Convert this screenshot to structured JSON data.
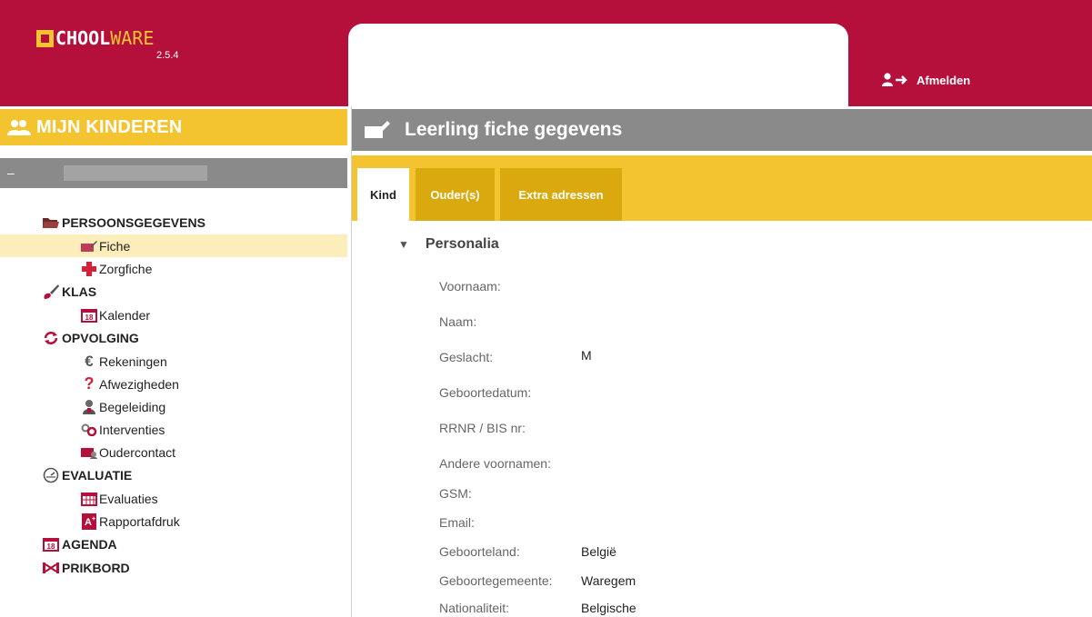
{
  "header": {
    "logo_text_main": "CHOOL",
    "logo_text_accent": "WARE",
    "version": "2.5.4",
    "logout_label": "Afmelden"
  },
  "sidebar": {
    "title": "MIJN KINDEREN",
    "collapse_symbol": "–",
    "sections": [
      {
        "label": "PERSOONSGEGEVENS",
        "icon": "folder-icon",
        "items": [
          {
            "label": "Fiche",
            "icon": "edit-card-icon",
            "active": true
          },
          {
            "label": "Zorgfiche",
            "icon": "red-cross-icon"
          }
        ]
      },
      {
        "label": "KLAS",
        "icon": "brush-icon",
        "items": [
          {
            "label": "Kalender",
            "icon": "calendar-icon"
          }
        ]
      },
      {
        "label": "OPVOLGING",
        "icon": "refresh-icon",
        "items": [
          {
            "label": "Rekeningen",
            "icon": "euro-icon"
          },
          {
            "label": "Afwezigheden",
            "icon": "question-icon"
          },
          {
            "label": "Begeleiding",
            "icon": "person-icon"
          },
          {
            "label": "Interventies",
            "icon": "link-icon"
          },
          {
            "label": "Oudercontact",
            "icon": "contact-icon"
          }
        ]
      },
      {
        "label": "EVALUATIE",
        "icon": "gauge-icon",
        "items": [
          {
            "label": "Evaluaties",
            "icon": "calendar-grid-icon"
          },
          {
            "label": "Rapportafdruk",
            "icon": "report-icon"
          }
        ]
      },
      {
        "label": "AGENDA",
        "icon": "calendar-icon",
        "items": []
      },
      {
        "label": "PRIKBORD",
        "icon": "pin-board-icon",
        "items": []
      }
    ]
  },
  "content": {
    "title": "Leerling fiche gegevens",
    "tabs": [
      {
        "label": "Kind",
        "active": true
      },
      {
        "label": "Ouder(s)"
      },
      {
        "label": "Extra adressen"
      }
    ],
    "section_title": "Personalia",
    "fields": [
      {
        "label": "Voornaam:",
        "value": ""
      },
      {
        "label": "Naam:",
        "value": ""
      },
      {
        "label": "Geslacht:",
        "value": "M"
      },
      {
        "label": "Geboortedatum:",
        "value": ""
      },
      {
        "label": "RRNR / BIS nr:",
        "value": ""
      },
      {
        "label": "Andere voornamen:",
        "value": ""
      },
      {
        "label": "GSM:",
        "value": ""
      },
      {
        "label": "Email:",
        "value": ""
      },
      {
        "label": "Geboorteland:",
        "value": "België"
      },
      {
        "label": "Geboortegemeente:",
        "value": "Waregem"
      },
      {
        "label": "Nationaliteit:",
        "value": "Belgische"
      }
    ]
  },
  "colors": {
    "brand_red": "#b5103c",
    "brand_yellow": "#f4c430",
    "tab_dark_yellow": "#d9a90e",
    "header_gray": "#8a8a8a",
    "active_row": "#fbeeba"
  }
}
